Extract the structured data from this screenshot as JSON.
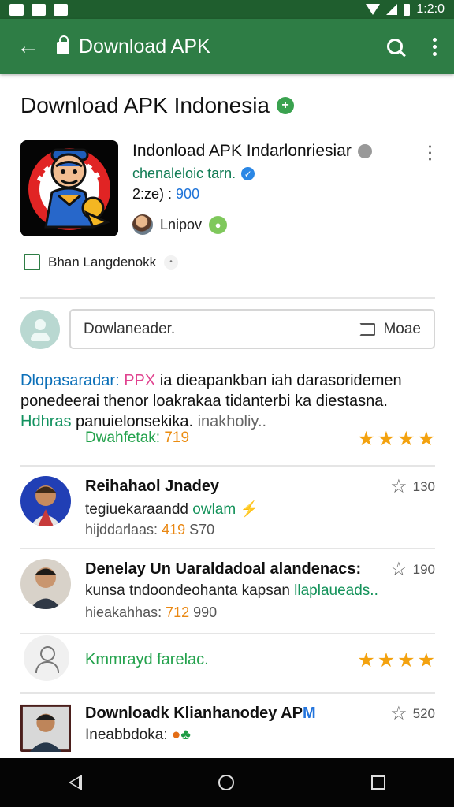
{
  "status_bar": {
    "time": "1:2:0"
  },
  "app_bar": {
    "title": "Download APK"
  },
  "page": {
    "title": "Download APK Indonesia",
    "title_badge": "+"
  },
  "app": {
    "name": "Indonload APK Indarlonriesiar",
    "developer": "chenaleloic tarn.",
    "stats_label": "2:ze) :",
    "stats_value": "900",
    "author": "Lnipov",
    "checkbox_label": "Bhan Langdenokk"
  },
  "comment": {
    "placeholder": "Dowlaneader.",
    "mode_label": "Moae"
  },
  "description": {
    "part_blue": "Dlopasaradar:",
    "part_pink": "PPX",
    "part_rest": "ia dieapankban iah darasoridemen ponedeerai thenor loakrakaa tidanterbi ka diestasna.",
    "part_green": "Hdhras",
    "part_end": "panuielonsekika.",
    "part_gray": "inakholiy..",
    "download_label": "Dwahfetak:",
    "download_value": "719"
  },
  "reviews": [
    {
      "name": "Reihahaol Jnadey",
      "subtitle": "tegiuekaraandd",
      "subtitle_link": "owlam",
      "meta": "hijddarlaas:",
      "meta_value": "419",
      "meta_extra": "S70",
      "rating": "130"
    },
    {
      "name": "Denelay Un Uaraldadoal alandenacs:",
      "subtitle": "kunsa tndoondeohanta kapsan",
      "subtitle_link": "llaplaueads..",
      "meta": "hieakahhas:",
      "meta_value": "712",
      "meta_extra": "990",
      "rating": "190"
    },
    {
      "name": "Downloadk Klianhanodey AP",
      "subtitle": "Ineabbdoka:",
      "subtitle_link": "",
      "meta": "",
      "meta_value": "",
      "meta_extra": "",
      "rating": "520"
    }
  ],
  "profile": {
    "label": "Kmmrayd farelac."
  },
  "icons": {
    "back": "back-arrow-icon",
    "search": "search-icon",
    "more": "more-vert-icon",
    "verified": "verified-icon",
    "star": "star-icon"
  },
  "colors": {
    "status_bar": "#1f5e2e",
    "app_bar": "#2e7d45",
    "accent_green": "#24a24d",
    "star_orange": "#f3a20f"
  }
}
